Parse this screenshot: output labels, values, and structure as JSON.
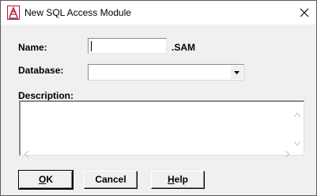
{
  "window": {
    "title": "New SQL Access Module",
    "app_icon": "sql-module-icon",
    "close_icon": "close-icon"
  },
  "form": {
    "name_label": "Name:",
    "name_value": "",
    "name_extension": ".SAM",
    "database_label": "Database:",
    "database_value": "",
    "description_label": "Description:",
    "description_value": ""
  },
  "buttons": {
    "ok": {
      "mnemonic": "O",
      "rest": "K"
    },
    "cancel": {
      "label": "Cancel"
    },
    "help": {
      "mnemonic": "H",
      "rest": "elp"
    }
  },
  "colors": {
    "face": "#f0f0f0",
    "title_bg": "#ffffff",
    "icon_red": "#c8102e"
  }
}
